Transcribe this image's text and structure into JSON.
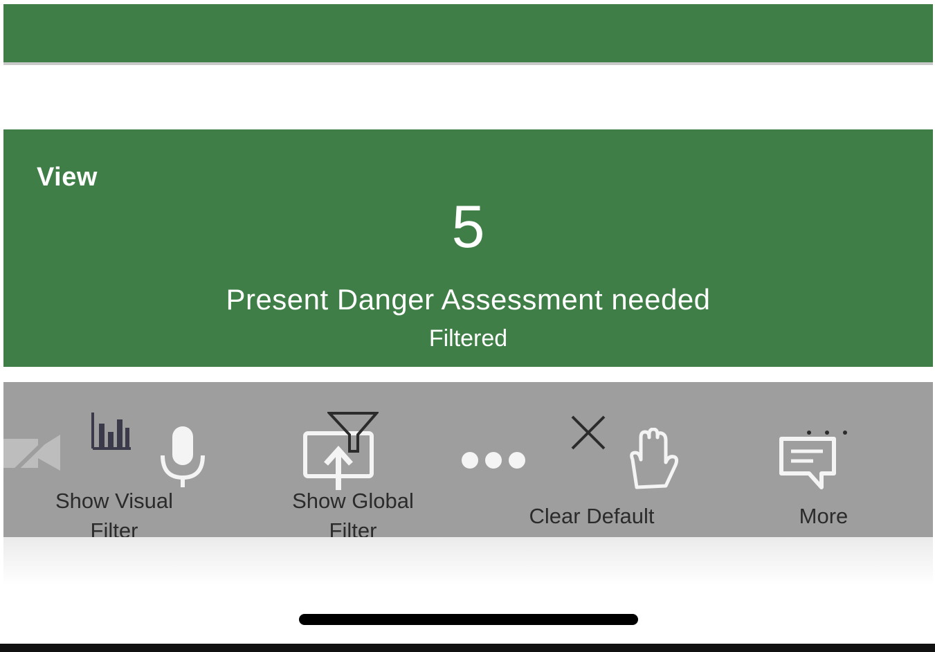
{
  "tile": {
    "label": "View",
    "count": "5",
    "title": "Present Danger Assessment needed",
    "subtitle": "Filtered"
  },
  "colors": {
    "tile_background": "#3f7f47",
    "toolbar_background": "#9e9e9e"
  },
  "toolbar": {
    "items": [
      {
        "label": "Show Visual Filter",
        "icon": "bar-chart-icon"
      },
      {
        "label": "Show Global Filter",
        "icon": "funnel-icon"
      },
      {
        "label": "Clear Default",
        "icon": "close-icon"
      },
      {
        "label": "More",
        "icon": "chat-icon"
      }
    ],
    "overlay_icons": [
      "video-off-icon",
      "microphone-icon",
      "share-screen-icon",
      "more-dots-icon",
      "raise-hand-icon",
      "overflow-dots-icon"
    ]
  }
}
